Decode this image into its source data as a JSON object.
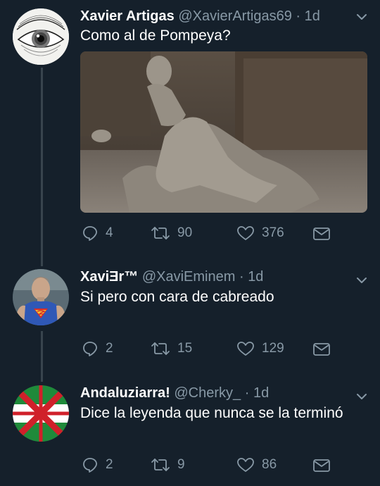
{
  "tweets": [
    {
      "name": "Xavier Artigas",
      "handle": "@XavierArtigas69",
      "dot": "·",
      "time": "1d",
      "text": "Como al de Pompeya?",
      "avatar_icon": "eye-icon",
      "has_media": true,
      "replies": "4",
      "retweets": "90",
      "likes": "376"
    },
    {
      "name": "XaviƎr™",
      "handle": "@XaviEminem",
      "dot": "·",
      "time": "1d",
      "text": "Si pero con cara de cabreado",
      "avatar_icon": "person-superman-shirt",
      "has_media": false,
      "replies": "2",
      "retweets": "15",
      "likes": "129"
    },
    {
      "name": "Andaluziarra!",
      "handle": "@Cherky_",
      "dot": "·",
      "time": "1d",
      "text": "Dice la leyenda que nunca se la terminó",
      "avatar_icon": "flag-icon",
      "has_media": false,
      "replies": "2",
      "retweets": "9",
      "likes": "86"
    }
  ],
  "colors": {
    "background": "#15202b",
    "secondary_text": "#8899a6",
    "thread_line": "#38444d"
  }
}
